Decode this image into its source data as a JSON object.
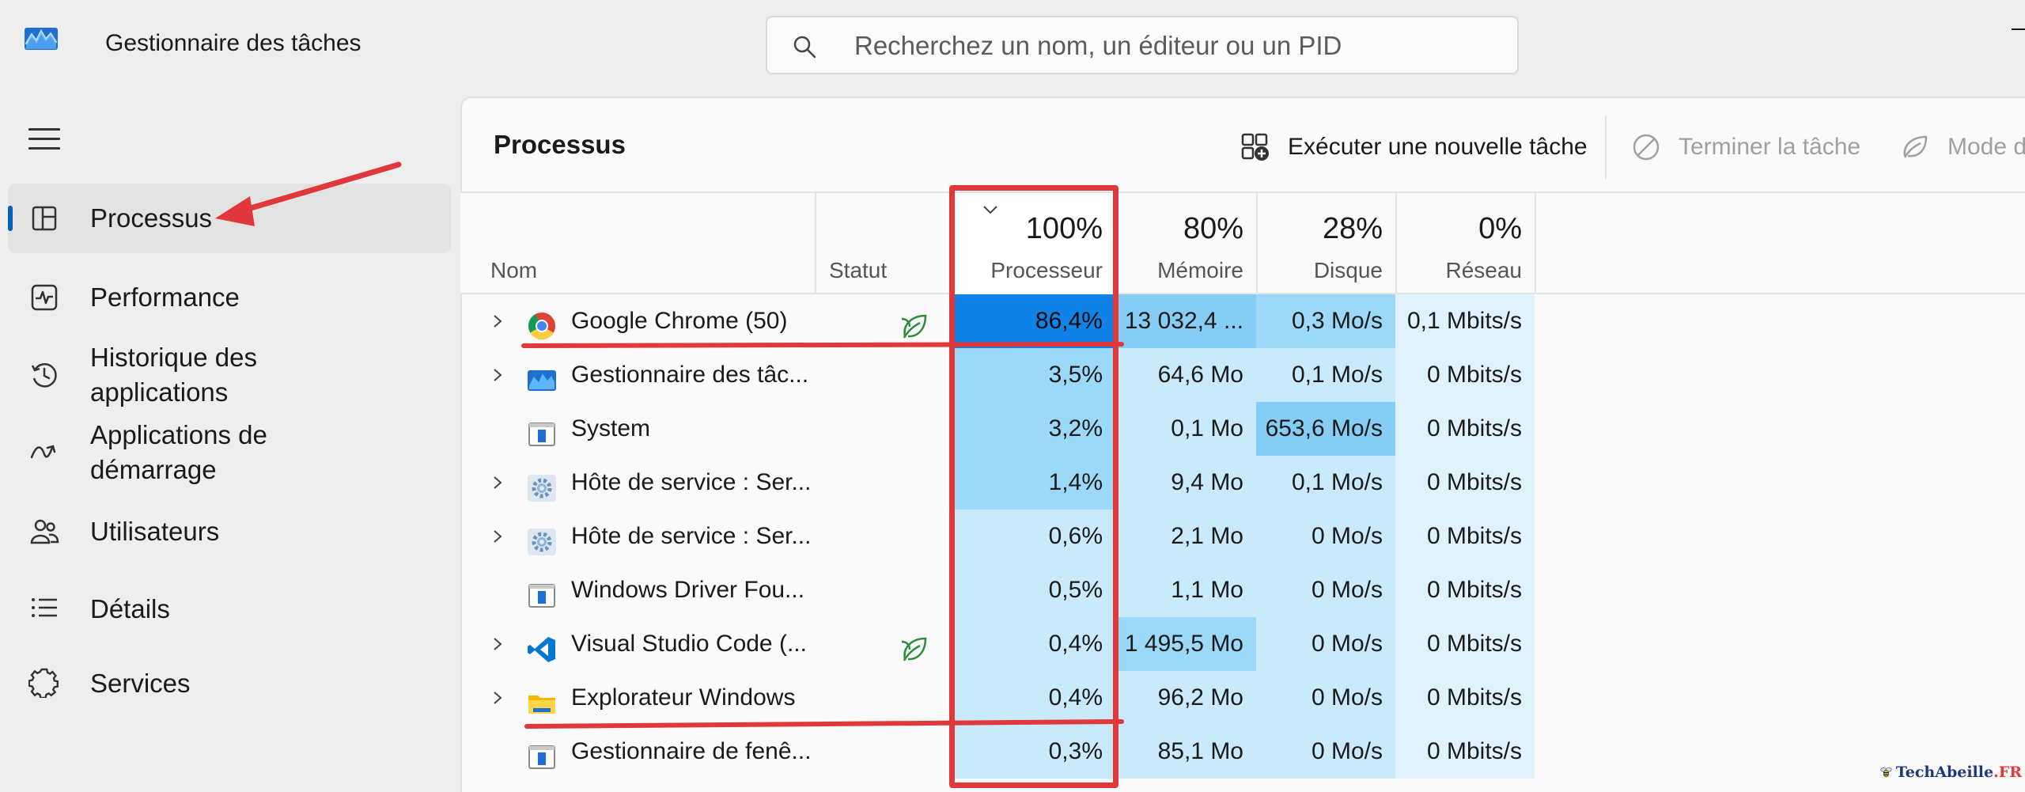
{
  "window": {
    "title": "Gestionnaire des tâches"
  },
  "search": {
    "placeholder": "Recherchez un nom, un éditeur ou un PID"
  },
  "sidebar": {
    "items": [
      {
        "label": "Processus",
        "icon": "processes-icon",
        "active": true
      },
      {
        "label": "Performance",
        "icon": "performance-icon",
        "active": false
      },
      {
        "label": "Historique des applications",
        "icon": "history-icon",
        "active": false
      },
      {
        "label": "Applications de démarrage",
        "icon": "startup-icon",
        "active": false
      },
      {
        "label": "Utilisateurs",
        "icon": "users-icon",
        "active": false
      },
      {
        "label": "Détails",
        "icon": "details-icon",
        "active": false
      },
      {
        "label": "Services",
        "icon": "services-icon",
        "active": false
      }
    ]
  },
  "main": {
    "title": "Processus",
    "toolbar": {
      "new_task": "Exécuter une nouvelle tâche",
      "end_task": "Terminer la tâche",
      "efficiency": "Mode d"
    }
  },
  "table": {
    "columns": {
      "name": "Nom",
      "status": "Statut",
      "cpu_pct": "100%",
      "cpu": "Processeur",
      "mem_pct": "80%",
      "mem": "Mémoire",
      "disk_pct": "28%",
      "disk": "Disque",
      "net_pct": "0%",
      "net": "Réseau"
    },
    "rows": [
      {
        "name": "Google Chrome (50)",
        "icon": "chrome-icon",
        "expandable": true,
        "eco": true,
        "cpu": "86,4%",
        "mem": "13 032,4 ...",
        "disk": "0,3 Mo/s",
        "net": "0,1 Mbits/s"
      },
      {
        "name": "Gestionnaire des tâc...",
        "icon": "task-manager-icon",
        "expandable": true,
        "eco": false,
        "cpu": "3,5%",
        "mem": "64,6 Mo",
        "disk": "0,1 Mo/s",
        "net": "0 Mbits/s"
      },
      {
        "name": "System",
        "icon": "window-icon",
        "expandable": false,
        "eco": false,
        "cpu": "3,2%",
        "mem": "0,1 Mo",
        "disk": "653,6 Mo/s",
        "net": "0 Mbits/s"
      },
      {
        "name": "Hôte de service : Ser...",
        "icon": "gear-icon",
        "expandable": true,
        "eco": false,
        "cpu": "1,4%",
        "mem": "9,4 Mo",
        "disk": "0,1 Mo/s",
        "net": "0 Mbits/s"
      },
      {
        "name": "Hôte de service : Ser...",
        "icon": "gear-icon",
        "expandable": true,
        "eco": false,
        "cpu": "0,6%",
        "mem": "2,1 Mo",
        "disk": "0 Mo/s",
        "net": "0 Mbits/s"
      },
      {
        "name": "Windows Driver Fou...",
        "icon": "window-icon",
        "expandable": false,
        "eco": false,
        "cpu": "0,5%",
        "mem": "1,1 Mo",
        "disk": "0 Mo/s",
        "net": "0 Mbits/s"
      },
      {
        "name": "Visual Studio Code (...",
        "icon": "vscode-icon",
        "expandable": true,
        "eco": true,
        "cpu": "0,4%",
        "mem": "1 495,5 Mo",
        "disk": "0 Mo/s",
        "net": "0 Mbits/s"
      },
      {
        "name": "Explorateur Windows",
        "icon": "folder-icon",
        "expandable": true,
        "eco": false,
        "cpu": "0,4%",
        "mem": "96,2 Mo",
        "disk": "0 Mo/s",
        "net": "0 Mbits/s"
      },
      {
        "name": "Gestionnaire de fenê...",
        "icon": "window-icon",
        "expandable": false,
        "eco": false,
        "cpu": "0,3%",
        "mem": "85,1 Mo",
        "disk": "0 Mo/s",
        "net": "0 Mbits/s"
      }
    ]
  },
  "heat_colors": {
    "none": "#dff2fd",
    "low": "#c8eafb",
    "medium": "#9cd8f8",
    "high": "#86cdf5",
    "max": "#0f83e8"
  },
  "row_heat": [
    {
      "cpu": "max",
      "mem": "high",
      "disk": "medium",
      "net": "none"
    },
    {
      "cpu": "medium",
      "mem": "low",
      "disk": "low",
      "net": "none"
    },
    {
      "cpu": "medium",
      "mem": "low",
      "disk": "high",
      "net": "none"
    },
    {
      "cpu": "medium",
      "mem": "low",
      "disk": "low",
      "net": "none"
    },
    {
      "cpu": "low",
      "mem": "low",
      "disk": "low",
      "net": "none"
    },
    {
      "cpu": "low",
      "mem": "low",
      "disk": "low",
      "net": "none"
    },
    {
      "cpu": "low",
      "mem": "medium",
      "disk": "low",
      "net": "none"
    },
    {
      "cpu": "low",
      "mem": "low",
      "disk": "low",
      "net": "none"
    },
    {
      "cpu": "low",
      "mem": "low",
      "disk": "low",
      "net": "none"
    }
  ],
  "annotation": {
    "color": "#e0383b"
  },
  "watermark": {
    "brand": "TechAbeille",
    "suffix": ".FR"
  }
}
